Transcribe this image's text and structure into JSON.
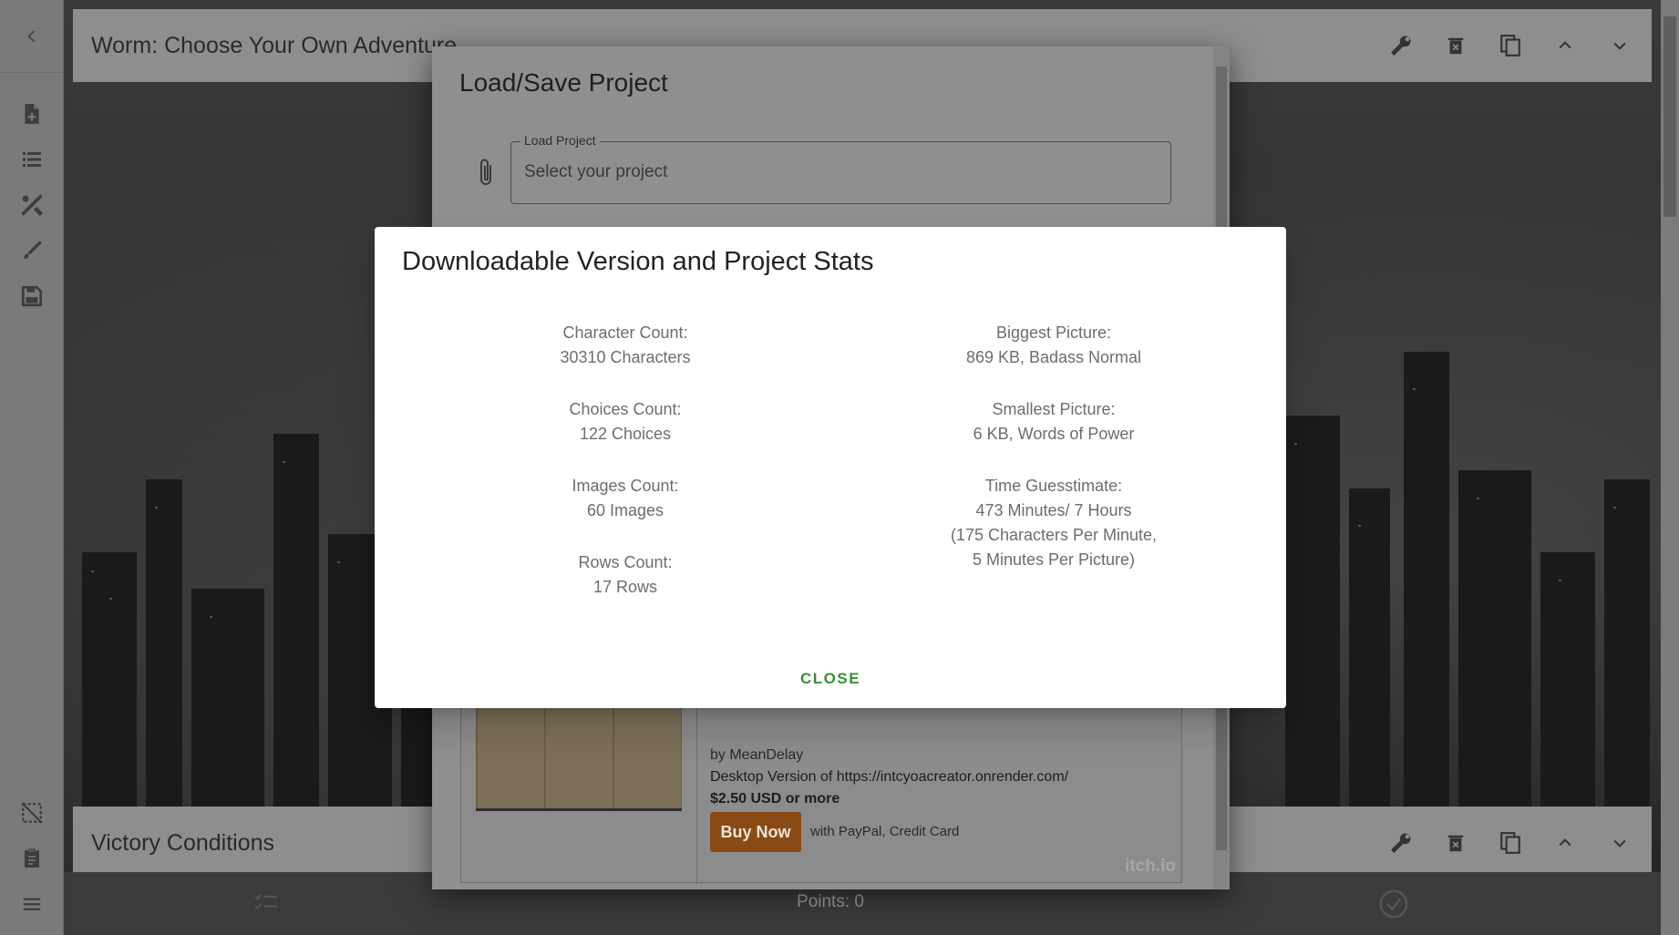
{
  "sidebar": {
    "back_icon": "chevron-left-icon",
    "items": [
      {
        "icon": "new-file-icon"
      },
      {
        "icon": "list-icon"
      },
      {
        "icon": "tools-icon"
      },
      {
        "icon": "brush-icon"
      },
      {
        "icon": "save-icon"
      },
      {
        "icon": "deselect-icon"
      },
      {
        "icon": "clipboard-icon"
      },
      {
        "icon": "menu-icon"
      }
    ]
  },
  "rows": {
    "top_title": "Worm: Choose Your Own Adventure",
    "bottom_title": "Victory Conditions"
  },
  "bottombar": {
    "points": "Points: 0"
  },
  "load_save": {
    "title": "Load/Save Project",
    "field_label": "Load Project",
    "field_placeholder": "Select your project",
    "itch": {
      "by": "by MeanDelay",
      "description": "Desktop Version of https://intcyoacreator.onrender.com/",
      "price": "$2.50 USD or more",
      "buy_label": "Buy Now",
      "with": "with PayPal, Credit Card",
      "logo": "itch.io"
    }
  },
  "modal": {
    "title": "Downloadable Version and Project Stats",
    "left_stats": [
      {
        "label": "Character Count:",
        "value": "30310 Characters"
      },
      {
        "label": "Choices Count:",
        "value": "122 Choices"
      },
      {
        "label": "Images Count:",
        "value": "60 Images"
      },
      {
        "label": "Rows Count:",
        "value": "17 Rows"
      }
    ],
    "right_stats": [
      {
        "label": "Biggest Picture:",
        "value": "869 KB, Badass Normal"
      },
      {
        "label": "Smallest Picture:",
        "value": "6 KB, Words of Power"
      },
      {
        "label": "Time Guesstimate:",
        "value": "473 Minutes/ 7 Hours",
        "extra1": "(175 Characters Per Minute,",
        "extra2": "5 Minutes Per Picture)"
      }
    ],
    "close_label": "CLOSE"
  },
  "colors": {
    "accent_green": "#3a8f3a",
    "itch_button": "#8a4a16"
  }
}
